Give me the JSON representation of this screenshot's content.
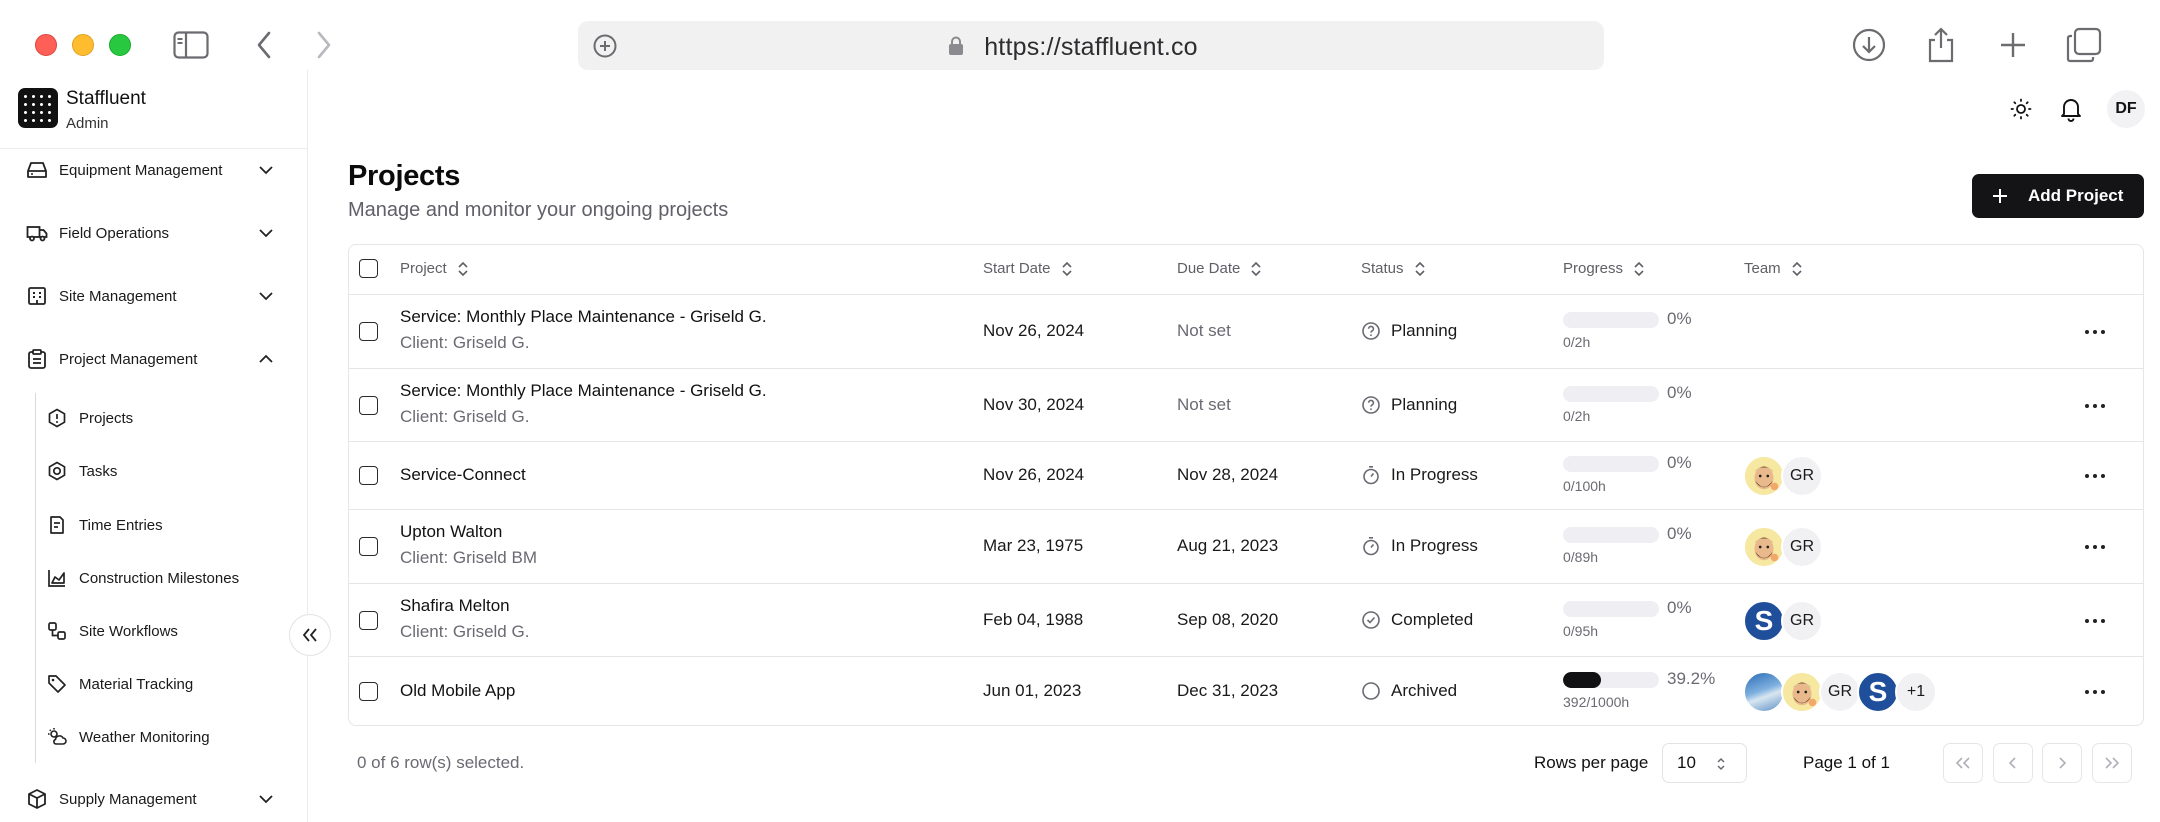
{
  "browser": {
    "url": "https://staffluent.co"
  },
  "sidebar": {
    "brand_name": "Staffluent",
    "brand_role": "Admin",
    "groups": [
      {
        "label": "Equipment Management",
        "expanded": false
      },
      {
        "label": "Field Operations",
        "expanded": false
      },
      {
        "label": "Site Management",
        "expanded": false
      },
      {
        "label": "Project Management",
        "expanded": true
      },
      {
        "label": "Supply Management",
        "expanded": false
      }
    ],
    "project_items": [
      {
        "label": "Projects"
      },
      {
        "label": "Tasks"
      },
      {
        "label": "Time Entries"
      },
      {
        "label": "Construction Milestones"
      },
      {
        "label": "Site Workflows"
      },
      {
        "label": "Material Tracking"
      },
      {
        "label": "Weather Monitoring"
      }
    ]
  },
  "header": {
    "user_initials": "DF"
  },
  "page": {
    "title": "Projects",
    "subtitle": "Manage and monitor your ongoing projects",
    "add_button": "Add Project"
  },
  "table": {
    "columns": [
      "Project",
      "Start Date",
      "Due Date",
      "Status",
      "Progress",
      "Team"
    ],
    "rows": [
      {
        "project": "Service: Monthly Place Maintenance - Griseld G.",
        "client": "Client: Griseld G.",
        "start": "Nov 26, 2024",
        "due": "Not set",
        "status": "Planning",
        "status_icon": "help-circle-icon",
        "progress": 0,
        "progress_label": "0%",
        "hours": "0/2h",
        "team": []
      },
      {
        "project": "Service: Monthly Place Maintenance - Griseld G.",
        "client": "Client: Griseld G.",
        "start": "Nov 30, 2024",
        "due": "Not set",
        "status": "Planning",
        "status_icon": "help-circle-icon",
        "progress": 0,
        "progress_label": "0%",
        "hours": "0/2h",
        "team": []
      },
      {
        "project": "Service-Connect",
        "client": "",
        "start": "Nov 26, 2024",
        "due": "Nov 28, 2024",
        "status": "In Progress",
        "status_icon": "timer-icon",
        "progress": 0,
        "progress_label": "0%",
        "hours": "0/100h",
        "team": [
          "emoji",
          "GR"
        ]
      },
      {
        "project": "Upton Walton",
        "client": "Client: Griseld BM",
        "start": "Mar 23, 1975",
        "due": "Aug 21, 2023",
        "status": "In Progress",
        "status_icon": "timer-icon",
        "progress": 0,
        "progress_label": "0%",
        "hours": "0/89h",
        "team": [
          "emoji",
          "GR"
        ]
      },
      {
        "project": "Shafira Melton",
        "client": "Client: Griseld G.",
        "start": "Feb 04, 1988",
        "due": "Sep 08, 2020",
        "status": "Completed",
        "status_icon": "check-circle-icon",
        "progress": 0,
        "progress_label": "0%",
        "hours": "0/95h",
        "team": [
          "S",
          "GR"
        ]
      },
      {
        "project": "Old Mobile App",
        "client": "",
        "start": "Jun 01, 2023",
        "due": "Dec 31, 2023",
        "status": "Archived",
        "status_icon": "circle-icon",
        "progress": 0.392,
        "progress_label": "39.2%",
        "hours": "392/1000h",
        "team": [
          "photo",
          "emoji",
          "GR",
          "S",
          "+1"
        ]
      }
    ]
  },
  "footer": {
    "selection": "0 of 6 row(s) selected.",
    "rows_per_page_label": "Rows per page",
    "rows_per_page_value": "10",
    "page_info": "Page 1 of 1"
  },
  "colors": {
    "primary": "#141416",
    "muted_text": "#6a6a72",
    "border": "#e6e6ea",
    "avatar_s": "#1f4f9a"
  }
}
